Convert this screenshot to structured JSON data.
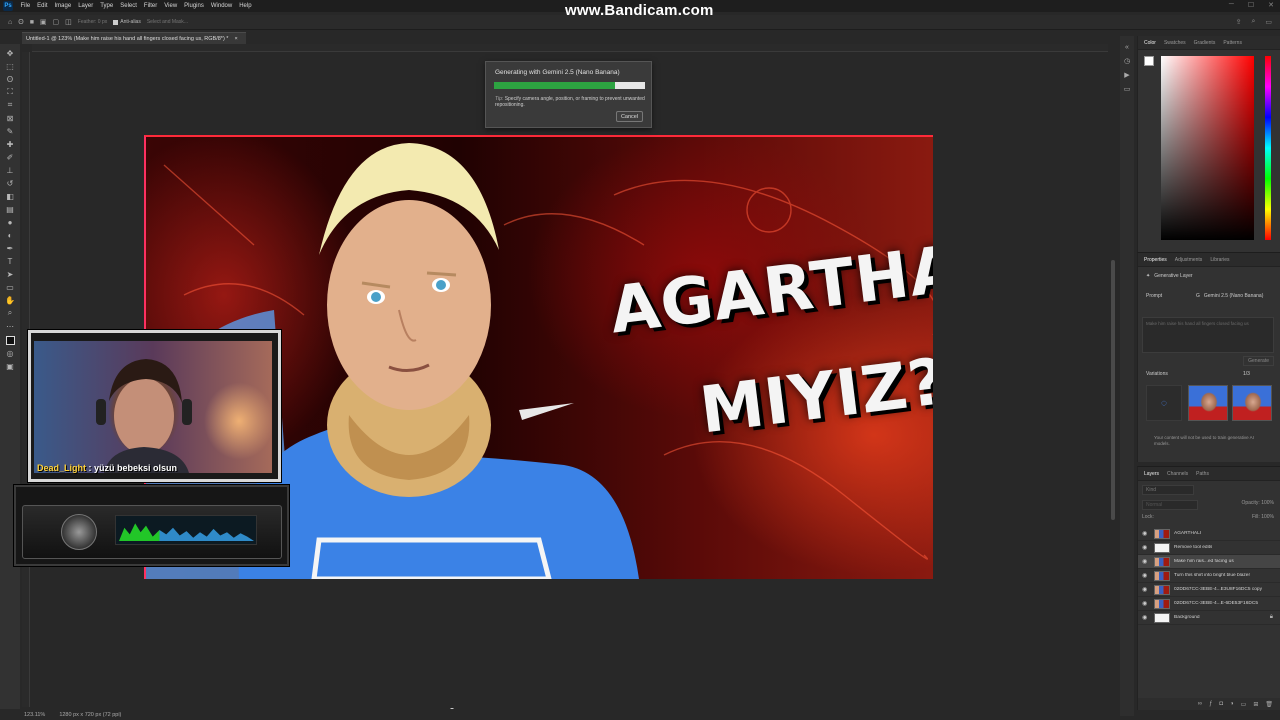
{
  "app": {
    "logo": "Ps",
    "menus": [
      "File",
      "Edit",
      "Image",
      "Layer",
      "Type",
      "Select",
      "Filter",
      "View",
      "Plugins",
      "Window",
      "Help"
    ],
    "watermark": "www.Bandicam.com"
  },
  "options_bar": {
    "feather_label": "Feather: 0 px",
    "antialias_label": "Anti-alias",
    "select_mask_label": "Select and Mask..."
  },
  "document": {
    "tab_title": "Untitled-1 @ 123% (Make him raise his hand all fingers closed facing us, RGB/8*) *",
    "close_glyph": "×"
  },
  "artwork": {
    "headline_line1": "AGARTHALI",
    "headline_line2": "MIYIZ?"
  },
  "generating_dialog": {
    "title": "Generating with Gemini 2.5 (Nano Banana)",
    "progress": 0.8,
    "tip_label": "Tip:",
    "tip_text": "Specify camera angle, position, or framing to prevent unwanted repositioning.",
    "cancel_label": "Cancel",
    "colors": {
      "progress_fill": "#2da341",
      "progress_track": "#e6e6e6"
    }
  },
  "stream_overlay": {
    "chat_user": "Dead_Light",
    "chat_separator": " : ",
    "chat_message": "yüzü bebeksi olsun"
  },
  "status_bar": {
    "zoom": "123.11%",
    "doc_size": "1280 px x 720 px (72 ppi)"
  },
  "color_panel": {
    "tabs": [
      "Color",
      "Swatches",
      "Gradients",
      "Patterns"
    ],
    "foreground": "#ffffff",
    "background": "#000000"
  },
  "properties_panel": {
    "tabs": [
      "Properties",
      "Adjustments",
      "Libraries"
    ],
    "layer_type": "Generative Layer",
    "prompt_label": "Prompt",
    "model": "Gemini 2.5 (Nano Banana)",
    "prompt_placeholder": "Make him raise his hand all fingers closed facing us",
    "generate_label": "Generate",
    "variations_label": "Variations",
    "variations_count": "1/3",
    "notice": "Your content will not be used to train generative AI models."
  },
  "layers_panel": {
    "tabs": [
      "Layers",
      "Channels",
      "Paths"
    ],
    "search_placeholder": "Kind",
    "blend_mode": "Normal",
    "opacity_label": "Opacity:",
    "opacity_value": "100%",
    "lock_label": "Lock:",
    "fill_label": "Fill:",
    "fill_value": "100%",
    "layers": [
      {
        "name": "AGARTHALI",
        "thumb": "art",
        "selected": false,
        "locked": false
      },
      {
        "name": "Remove tool edits",
        "thumb": "white",
        "selected": false,
        "locked": false
      },
      {
        "name": "Make him rais...ed facing us",
        "thumb": "art",
        "selected": true,
        "locked": false
      },
      {
        "name": "Turn this shirt into bright blue blazer",
        "thumb": "art",
        "selected": false,
        "locked": false
      },
      {
        "name": "02DD67CC-3EBE-4...E3U8F16DC5 copy",
        "thumb": "art",
        "selected": false,
        "locked": false
      },
      {
        "name": "02DD67CC-3EBE-4...E-6DE53F16DC5",
        "thumb": "art",
        "selected": false,
        "locked": false
      },
      {
        "name": "Background",
        "thumb": "white",
        "selected": false,
        "locked": true
      }
    ]
  },
  "icons": {
    "eye": "visibility-eye-icon",
    "lock": "lock-icon",
    "search": "search-icon",
    "spinner": "loading-spinner-icon"
  }
}
